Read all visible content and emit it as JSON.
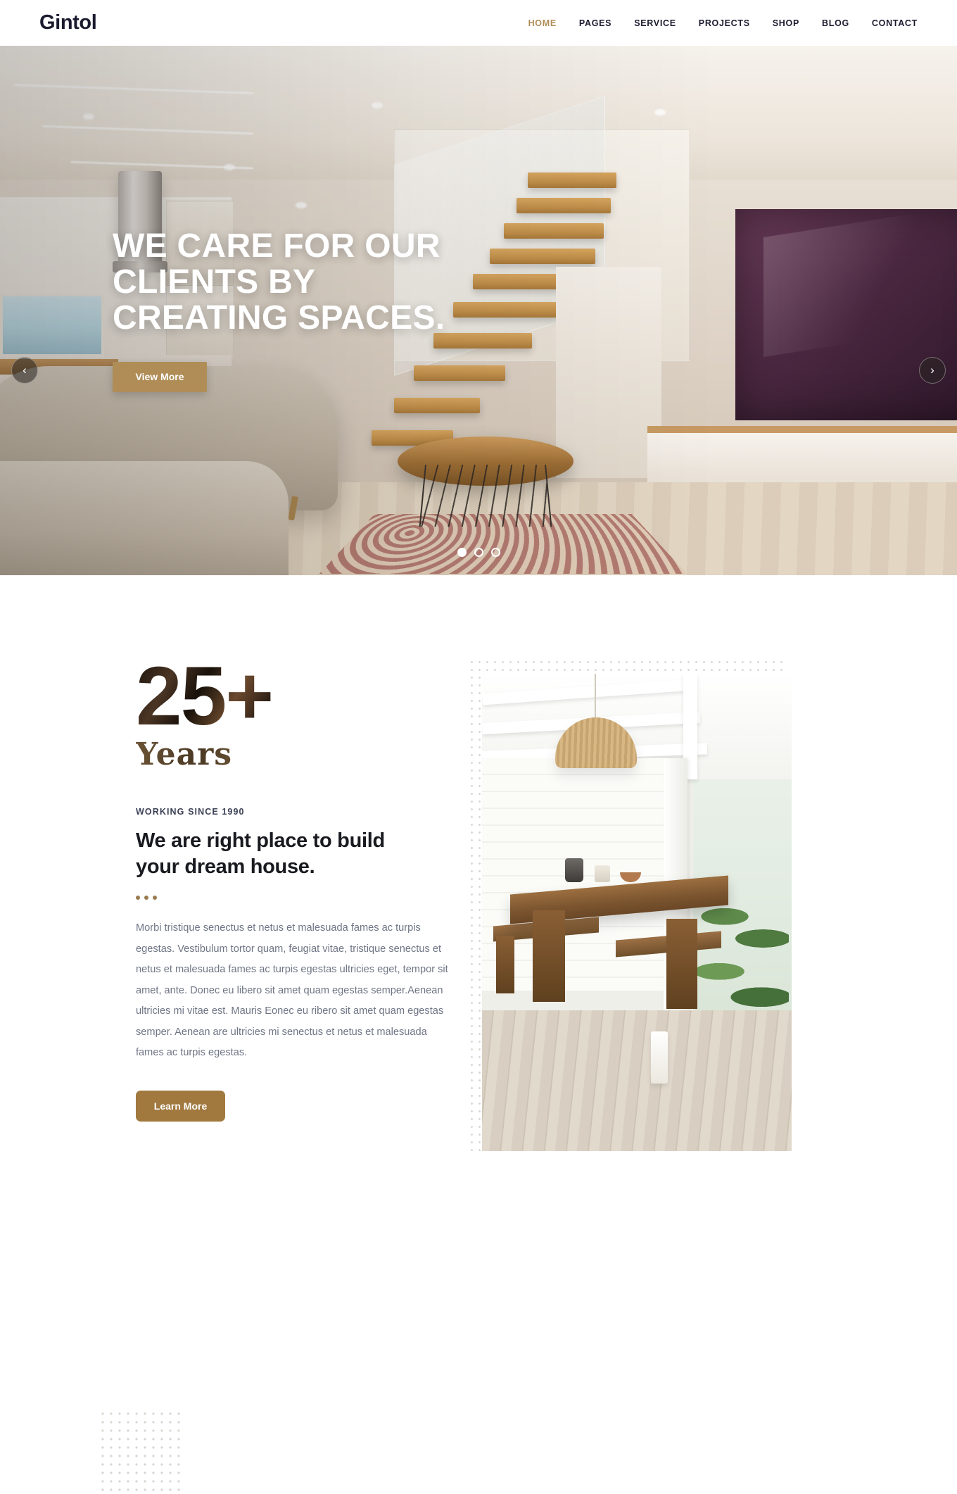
{
  "header": {
    "brand": "Gintol",
    "nav": [
      {
        "label": "HOME",
        "active": true
      },
      {
        "label": "PAGES",
        "active": false
      },
      {
        "label": "SERVICE",
        "active": false
      },
      {
        "label": "PROJECTS",
        "active": false
      },
      {
        "label": "SHOP",
        "active": false
      },
      {
        "label": "BLOG",
        "active": false
      },
      {
        "label": "CONTACT",
        "active": false
      }
    ]
  },
  "hero": {
    "title": "WE CARE FOR OUR CLIENTS BY CREATING SPACES.",
    "cta_label": "View More",
    "prev_icon": "‹",
    "next_icon": "›",
    "slides": 3,
    "active_slide": 1
  },
  "about": {
    "years_number": "25+",
    "years_word": "Years",
    "eyebrow": "WORKING SINCE 1990",
    "heading": "We are right place to build your dream house.",
    "paragraph": "Morbi tristique senectus et netus et malesuada fames ac turpis egestas. Vestibulum tortor quam, feugiat vitae, tristique senectus et netus et malesuada fames ac turpis egestas ultricies eget, tempor sit amet, ante. Donec eu libero sit amet quam egestas semper.Aenean ultricies mi vitae est. Mauris Eonec eu ribero sit amet quam egestas semper. Aenean are ultricies mi senectus et netus et malesuada fames ac turpis egestas.",
    "cta_label": "Learn More"
  },
  "colors": {
    "accent_gold": "#b08d57",
    "button_brown": "#a1793f",
    "text_dark": "#191a20",
    "text_body": "#6f7585",
    "eyebrow": "#3c4257"
  }
}
